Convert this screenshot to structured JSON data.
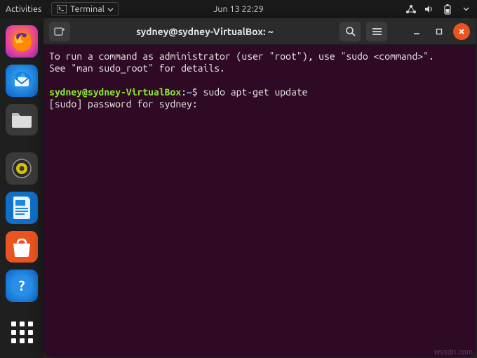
{
  "topbar": {
    "activities": "Activities",
    "terminal_dropdown": "Terminal",
    "datetime": "Jun 13  22:29"
  },
  "dock": {
    "firefox": "firefox",
    "thunderbird": "thunderbird",
    "files": "files",
    "rhythmbox": "rhythmbox",
    "libreoffice": "libreoffice-writer",
    "software": "ubuntu-software",
    "help": "help",
    "apps": "show-applications"
  },
  "window": {
    "title": "sydney@sydney-VirtualBox: ~"
  },
  "terminal": {
    "motd_line1": "To run a command as administrator (user \"root\"), use \"sudo <command>\".",
    "motd_line2": "See \"man sudo_root\" for details.",
    "prompt_userhost": "sydney@sydney-VirtualBox",
    "prompt_sep": ":",
    "prompt_path": "~",
    "prompt_symbol": "$",
    "command": "sudo apt-get update",
    "output_line1": "[sudo] password for sydney:"
  },
  "watermark": "wsxdn.com"
}
